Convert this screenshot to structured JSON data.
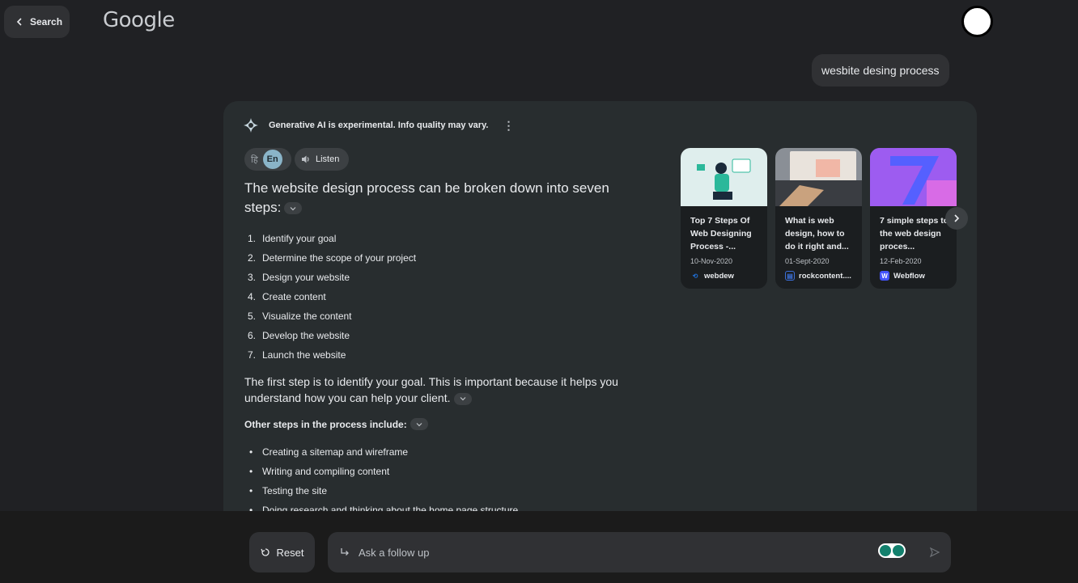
{
  "header": {
    "back_label": "Search",
    "logo_text": "Google"
  },
  "query": "wesbite desing process",
  "ai": {
    "disclaimer": "Generative AI is experimental. Info quality may vary.",
    "lang_hi": "हि",
    "lang_en": "En",
    "listen_label": "Listen",
    "headline": "The website design process can be broken down into seven steps:",
    "steps": [
      {
        "num": "1.",
        "text": "Identify your goal"
      },
      {
        "num": "2.",
        "text": "Determine the scope of your project"
      },
      {
        "num": "3.",
        "text": "Design your website"
      },
      {
        "num": "4.",
        "text": "Create content"
      },
      {
        "num": "5.",
        "text": "Visualize the content"
      },
      {
        "num": "6.",
        "text": "Develop the website"
      },
      {
        "num": "7.",
        "text": "Launch the website"
      }
    ],
    "para_plain": "The first step is to ",
    "para_bold": "identify your goal. This is important because it helps you understand how you can help your client.",
    "other_plain": "Other steps ",
    "other_bold": "in the process include:",
    "bullets": [
      "Creating a sitemap and wireframe",
      "Writing and compiling content",
      "Testing the site",
      "Doing research and thinking about the home page structure"
    ]
  },
  "sources": [
    {
      "title": "Top 7 Steps Of Web Designing Process -...",
      "date": "10-Nov-2020",
      "site": "webdew",
      "fav_color": "#1f6fd6",
      "thumb_color": "#dfeeed"
    },
    {
      "title": "What is web design, how to do it right and...",
      "date": "01-Sept-2020",
      "site": "rockcontent....",
      "fav_color": "#3b6fd9",
      "thumb_color": "#8a8f96"
    },
    {
      "title": "7 simple steps to the web design proces...",
      "date": "12-Feb-2020",
      "site": "Webflow",
      "fav_color": "#4353ff",
      "thumb_color": "#8e55e8"
    }
  ],
  "footer": {
    "reset_label": "Reset",
    "followup_placeholder": "Ask a follow up"
  }
}
